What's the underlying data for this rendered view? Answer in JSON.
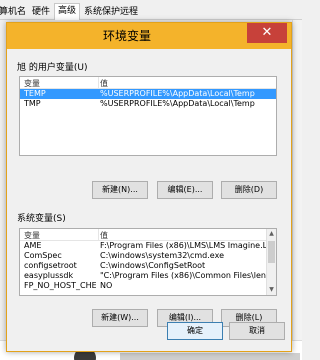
{
  "background_window": {
    "tabs": [
      "计算机名",
      "硬件",
      "高级",
      "系统保护",
      "远程"
    ],
    "active_tab_index": 2
  },
  "dialog": {
    "title": "环境变量",
    "close_glyph": "✕",
    "user_vars": {
      "label": "旭 的用户变量(U)",
      "columns": [
        "变量",
        "值"
      ],
      "rows": [
        {
          "name": "TEMP",
          "value": "%USERPROFILE%\\AppData\\Local\\Temp",
          "selected": true
        },
        {
          "name": "TMP",
          "value": "%USERPROFILE%\\AppData\\Local\\Temp",
          "selected": false
        }
      ],
      "buttons": {
        "new": "新建(N)...",
        "edit": "编辑(E)...",
        "delete": "删除(D)"
      }
    },
    "system_vars": {
      "label": "系统变量(S)",
      "columns": [
        "变量",
        "值"
      ],
      "rows": [
        {
          "name": "AME",
          "value": "F:\\Program Files (x86)\\LMS\\LMS Imagine.La..."
        },
        {
          "name": "ComSpec",
          "value": "C:\\windows\\system32\\cmd.exe"
        },
        {
          "name": "configsetroot",
          "value": "C:\\windows\\ConfigSetRoot"
        },
        {
          "name": "easyplussdk",
          "value": "\"C:\\Program Files (x86)\\Common Files\\lenov..."
        },
        {
          "name": "FP_NO_HOST_CHE...",
          "value": "NO"
        }
      ],
      "buttons": {
        "new": "新建(W)...",
        "edit": "编辑(I)...",
        "delete": "删除(L)"
      }
    },
    "ok_label": "确定",
    "cancel_label": "取消"
  },
  "colors": {
    "titlebar": "#f4b32b",
    "close_button": "#c7413a",
    "selection": "#3399ff"
  }
}
